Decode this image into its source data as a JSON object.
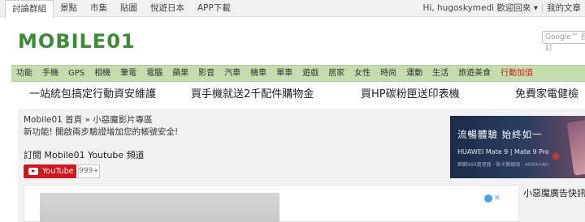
{
  "topbar": {
    "nav": [
      "討論群組",
      "景點",
      "市集",
      "貼圖",
      "悅遊日本",
      "APP下載"
    ],
    "active_index": 0,
    "user_greeting": "Hi, hugoskymedi 歡迎回來 ▾",
    "my_posts": "我的文章"
  },
  "header": {
    "logo_text": "MOBILE01",
    "search_placeholder": "Google™ 自訂"
  },
  "categories": {
    "items": [
      "功能",
      "手機",
      "GPS",
      "相機",
      "筆電",
      "電腦",
      "蘋果",
      "影音",
      "汽車",
      "機車",
      "單車",
      "遊戲",
      "居家",
      "女性",
      "時尚",
      "運動",
      "生活",
      "旅遊美食"
    ],
    "highlight": "行動加值",
    "highlight_color": "#c0281e"
  },
  "promo": {
    "links": [
      "一站統包搞定行動資安維護",
      "買手機就送2千配件購物金",
      "買HP碳粉匣送印表機",
      "免費家電健檢"
    ]
  },
  "main": {
    "breadcrumb": "Mobile01 首頁 » 小惡魔影片專區",
    "notice": "新功能! 開啟兩步驗證增加您的帳號安全!",
    "subscribe_title": "訂閱 Mobile01 Youtube 頻道",
    "youtube_label": "YouTube",
    "subscriber_count": "999+"
  },
  "ad": {
    "headline": "流暢體驗 始終如一",
    "subline": "HUAWEI Mate 9 | Mate 9 Pro",
    "fineprint": "麒麟960處理器 · 徠卡雙鏡頭 · 4000mAh"
  },
  "sidebar": {
    "title": "小惡魔廣告快訊"
  }
}
